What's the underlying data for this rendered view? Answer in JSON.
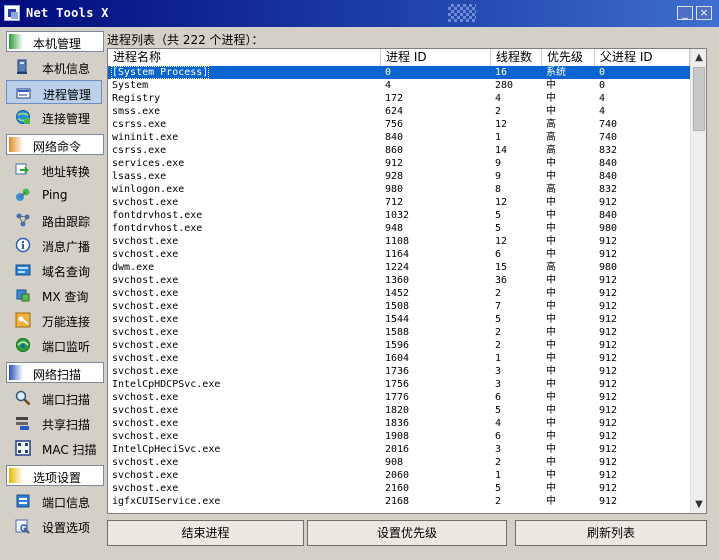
{
  "window": {
    "title": "Net Tools X",
    "min_label": "_",
    "close_label": "×"
  },
  "sidebar": {
    "groups": [
      {
        "label": "本机管理",
        "color": "#2e9a3e",
        "items": [
          {
            "label": "本机信息",
            "icon": "computer-icon",
            "selected": false
          },
          {
            "label": "进程管理",
            "icon": "process-icon",
            "selected": true
          },
          {
            "label": "连接管理",
            "icon": "network-globe-icon",
            "selected": false
          }
        ]
      },
      {
        "label": "网络命令",
        "color": "#e08a1e",
        "items": [
          {
            "label": "地址转换",
            "icon": "address-convert-icon",
            "selected": false
          },
          {
            "label": "Ping",
            "icon": "ping-icon",
            "selected": false
          },
          {
            "label": "路由跟踪",
            "icon": "route-trace-icon",
            "selected": false
          },
          {
            "label": "消息广播",
            "icon": "info-broadcast-icon",
            "selected": false
          },
          {
            "label": "域名查询",
            "icon": "domain-lookup-icon",
            "selected": false
          },
          {
            "label": "MX 查询",
            "icon": "mx-lookup-icon",
            "selected": false
          },
          {
            "label": "万能连接",
            "icon": "key-connect-icon",
            "selected": false
          },
          {
            "label": "端口监听",
            "icon": "port-listen-icon",
            "selected": false
          }
        ]
      },
      {
        "label": "网络扫描",
        "color": "#2a52b8",
        "items": [
          {
            "label": "端口扫描",
            "icon": "magnifier-icon",
            "selected": false
          },
          {
            "label": "共享扫描",
            "icon": "share-scan-icon",
            "selected": false
          },
          {
            "label": "MAC 扫描",
            "icon": "mac-scan-icon",
            "selected": false
          }
        ]
      },
      {
        "label": "选项设置",
        "color": "#e6b800",
        "items": [
          {
            "label": "端口信息",
            "icon": "port-info-icon",
            "selected": false
          },
          {
            "label": "设置选项",
            "icon": "settings-icon",
            "selected": false
          }
        ]
      }
    ]
  },
  "main": {
    "caption": "进程列表（共 222 个进程）：",
    "columns": [
      "进程名称",
      "进程 ID",
      "线程数",
      "优先级",
      "父进程 ID"
    ],
    "rows": [
      [
        "[System Process]",
        "0",
        "16",
        "系统",
        "0"
      ],
      [
        "System",
        "4",
        "280",
        "中",
        "0"
      ],
      [
        "Registry",
        "172",
        "4",
        "中",
        "4"
      ],
      [
        "smss.exe",
        "624",
        "2",
        "中",
        "4"
      ],
      [
        "csrss.exe",
        "756",
        "12",
        "高",
        "740"
      ],
      [
        "wininit.exe",
        "840",
        "1",
        "高",
        "740"
      ],
      [
        "csrss.exe",
        "860",
        "14",
        "高",
        "832"
      ],
      [
        "services.exe",
        "912",
        "9",
        "中",
        "840"
      ],
      [
        "lsass.exe",
        "928",
        "9",
        "中",
        "840"
      ],
      [
        "winlogon.exe",
        "980",
        "8",
        "高",
        "832"
      ],
      [
        "svchost.exe",
        "712",
        "12",
        "中",
        "912"
      ],
      [
        "fontdrvhost.exe",
        "1032",
        "5",
        "中",
        "840"
      ],
      [
        "fontdrvhost.exe",
        "948",
        "5",
        "中",
        "980"
      ],
      [
        "svchost.exe",
        "1108",
        "12",
        "中",
        "912"
      ],
      [
        "svchost.exe",
        "1164",
        "6",
        "中",
        "912"
      ],
      [
        "dwm.exe",
        "1224",
        "15",
        "高",
        "980"
      ],
      [
        "svchost.exe",
        "1360",
        "36",
        "中",
        "912"
      ],
      [
        "svchost.exe",
        "1452",
        "2",
        "中",
        "912"
      ],
      [
        "svchost.exe",
        "1508",
        "7",
        "中",
        "912"
      ],
      [
        "svchost.exe",
        "1544",
        "5",
        "中",
        "912"
      ],
      [
        "svchost.exe",
        "1588",
        "2",
        "中",
        "912"
      ],
      [
        "svchost.exe",
        "1596",
        "2",
        "中",
        "912"
      ],
      [
        "svchost.exe",
        "1604",
        "1",
        "中",
        "912"
      ],
      [
        "svchost.exe",
        "1736",
        "3",
        "中",
        "912"
      ],
      [
        "IntelCpHDCPSvc.exe",
        "1756",
        "3",
        "中",
        "912"
      ],
      [
        "svchost.exe",
        "1776",
        "6",
        "中",
        "912"
      ],
      [
        "svchost.exe",
        "1820",
        "5",
        "中",
        "912"
      ],
      [
        "svchost.exe",
        "1836",
        "4",
        "中",
        "912"
      ],
      [
        "svchost.exe",
        "1908",
        "6",
        "中",
        "912"
      ],
      [
        "IntelCpHeciSvc.exe",
        "2016",
        "3",
        "中",
        "912"
      ],
      [
        "svchost.exe",
        "908",
        "2",
        "中",
        "912"
      ],
      [
        "svchost.exe",
        "2060",
        "1",
        "中",
        "912"
      ],
      [
        "svchost.exe",
        "2160",
        "5",
        "中",
        "912"
      ],
      [
        "igfxCUIService.exe",
        "2168",
        "2",
        "中",
        "912"
      ]
    ],
    "selected_row": 0,
    "scroll": {
      "up": "▲",
      "down": "▼"
    }
  },
  "buttons": {
    "end_process": "结束进程",
    "set_priority": "设置优先级",
    "refresh": "刷新列表"
  }
}
